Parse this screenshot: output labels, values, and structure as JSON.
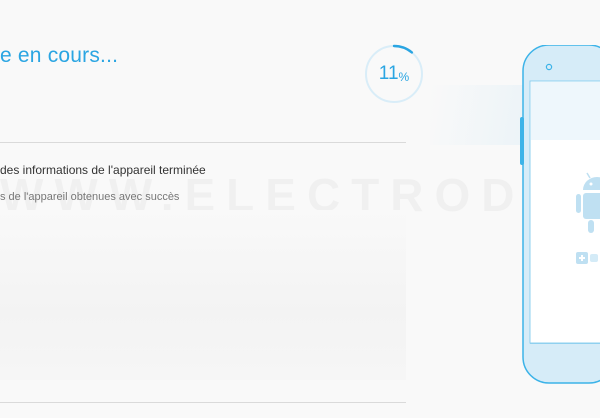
{
  "header": {
    "title": "e en cours..."
  },
  "progress": {
    "value": 11,
    "number": "11",
    "unit": "%"
  },
  "step": {
    "title": "des informations de l'appareil terminée",
    "subtitle": "s de l'appareil obtenues avec succès"
  },
  "watermark": "WWW.ELECTRODZ.C",
  "colors": {
    "accent": "#2aa5e2",
    "ring_track": "#d9edf8",
    "phone_body": "#d6ecf8",
    "phone_stroke": "#3cb3e8"
  },
  "icons": {
    "phone": "phone-icon",
    "android": "android-icon",
    "plus": "plus-icon"
  }
}
